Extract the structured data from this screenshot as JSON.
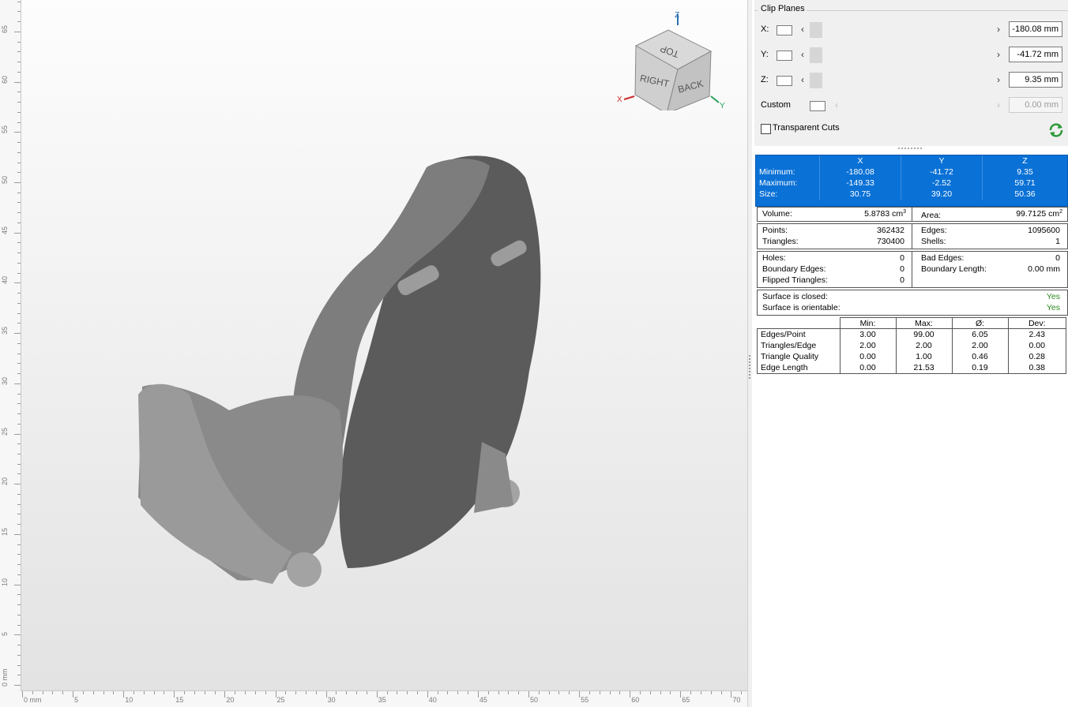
{
  "rulers": {
    "vertical_labels": [
      "0 mm",
      "5",
      "10",
      "15",
      "20",
      "25",
      "30",
      "35",
      "40",
      "45",
      "50",
      "55",
      "60",
      "65"
    ],
    "horizontal_labels": [
      "0 mm",
      "5",
      "10",
      "15",
      "20",
      "25",
      "30",
      "35",
      "40",
      "45",
      "50",
      "55",
      "60",
      "65",
      "70"
    ]
  },
  "view_cube": {
    "top": "TOP",
    "right": "RIGHT",
    "back": "BACK",
    "axis_x": "X",
    "axis_y": "Y",
    "axis_z": "Z"
  },
  "clip_planes": {
    "title": "Clip Planes",
    "rows": [
      {
        "label": "X:",
        "value": "-180.08 mm"
      },
      {
        "label": "Y:",
        "value": "-41.72 mm"
      },
      {
        "label": "Z:",
        "value": "9.35 mm"
      },
      {
        "label": "Custom",
        "value": "0.00 mm"
      }
    ],
    "transparent_cuts": "Transparent Cuts"
  },
  "extents": {
    "headers": [
      "X",
      "Y",
      "Z"
    ],
    "rows": [
      {
        "label": "Minimum:",
        "x": "-180.08",
        "y": "-41.72",
        "z": "9.35"
      },
      {
        "label": "Maximum:",
        "x": "-149.33",
        "y": "-2.52",
        "z": "59.71"
      },
      {
        "label": "Size:",
        "x": "30.75",
        "y": "39.20",
        "z": "50.36"
      }
    ]
  },
  "volume_area": {
    "volume_label": "Volume:",
    "volume_value": "5.8783 cm",
    "area_label": "Area:",
    "area_value": "99.7125 cm"
  },
  "topology": {
    "points_label": "Points:",
    "points": "362432",
    "triangles_label": "Triangles:",
    "triangles": "730400",
    "edges_label": "Edges:",
    "edges": "1095600",
    "shells_label": "Shells:",
    "shells": "1"
  },
  "defects": {
    "holes_label": "Holes:",
    "holes": "0",
    "boundary_edges_label": "Boundary Edges:",
    "boundary_edges": "0",
    "flipped_label": "Flipped Triangles:",
    "flipped": "0",
    "bad_edges_label": "Bad Edges:",
    "bad_edges": "0",
    "boundary_length_label": "Boundary Length:",
    "boundary_length": "0.00 mm"
  },
  "surface": {
    "closed_label": "Surface is closed:",
    "closed": "Yes",
    "orientable_label": "Surface is orientable:",
    "orientable": "Yes",
    "ok_color": "#2e8b20"
  },
  "quality_stats": {
    "headers": [
      "Min:",
      "Max:",
      "Ø:",
      "Dev:"
    ],
    "rows": [
      {
        "label": "Edges/Point",
        "min": "3.00",
        "max": "99.00",
        "avg": "6.05",
        "dev": "2.43"
      },
      {
        "label": "Triangles/Edge",
        "min": "2.00",
        "max": "2.00",
        "avg": "2.00",
        "dev": "0.00"
      },
      {
        "label": "Triangle Quality",
        "min": "0.00",
        "max": "1.00",
        "avg": "0.46",
        "dev": "0.28"
      },
      {
        "label": "Edge Length",
        "min": "0.00",
        "max": "21.53",
        "avg": "0.19",
        "dev": "0.38"
      }
    ]
  },
  "colors": {
    "selection": "#0a71d6",
    "axis_x": "#cc2b2b",
    "axis_y": "#2aa05a",
    "axis_z": "#2a6fb0"
  }
}
